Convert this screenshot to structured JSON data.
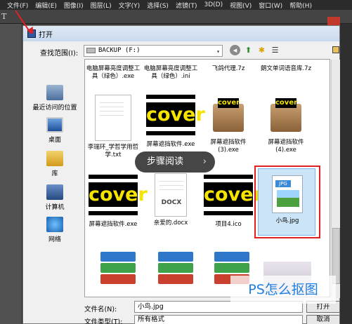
{
  "ps": {
    "menu": [
      "文件(F)",
      "编辑(E)",
      "图像(I)",
      "图层(L)",
      "文字(Y)",
      "选择(S)",
      "滤镜(T)",
      "3D(D)",
      "视图(V)",
      "窗口(W)",
      "帮助(H)"
    ],
    "tool_letter": "T"
  },
  "dialog": {
    "title": "打开",
    "lookin_label": "查找范围(I):",
    "lookin_value": "BACKUP (F:)"
  },
  "places": [
    {
      "label": "最近访问的位置",
      "icon": "recent-places-icon"
    },
    {
      "label": "桌面",
      "icon": "desktop-icon"
    },
    {
      "label": "库",
      "icon": "libraries-icon"
    },
    {
      "label": "计算机",
      "icon": "computer-icon"
    },
    {
      "label": "网络",
      "icon": "network-icon"
    }
  ],
  "files": {
    "r0": [
      "电脑屏幕亮度调整工具（绿色）.exe",
      "电脑屏幕亮度调整工具（绿色）.ini",
      "飞鸽代理.7z",
      "朗文单词语音库.7z"
    ],
    "r1": [
      "李瑞环_学哲学用哲学.txt",
      "屏幕遮挡软件.exe",
      "屏幕遮挡软件(3).exe",
      "屏幕遮挡软件(4).exe"
    ],
    "r2": [
      "屏幕遮挡软件.exe",
      "亲爱的.docx",
      "项目4.ico",
      "小鸟.jpg"
    ]
  },
  "thumb_text": {
    "cover": "cover",
    "docx": "DOCX",
    "jpg": "JPG"
  },
  "overlay": {
    "label": "步骤阅读"
  },
  "bottom": {
    "filename_label": "文件名(N):",
    "filename_value": "小鸟.jpg",
    "filetype_label": "文件类型(T):",
    "filetype_value": "所有格式",
    "open_label": "打开",
    "cancel_label": "取消"
  },
  "watermark": "PS怎么抠图",
  "colors": {
    "highlight": "#e02020",
    "selection": "#cce4f7",
    "watermark": "#1f7fe0"
  }
}
